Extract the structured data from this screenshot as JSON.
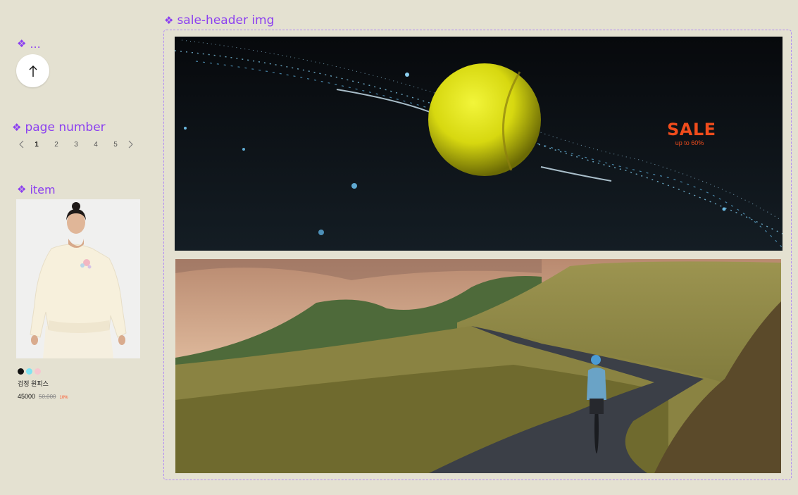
{
  "labels": {
    "scroll": "...",
    "page_number": "page number",
    "item": "item",
    "sale_header": "sale-header img"
  },
  "component_glyph": "❖",
  "scroll_top": {
    "icon": "arrow-up-icon"
  },
  "pager": {
    "prev_icon": "chevron-left-icon",
    "next_icon": "chevron-right-icon",
    "pages": [
      "1",
      "2",
      "3",
      "4",
      "5"
    ],
    "active": "1"
  },
  "item": {
    "name": "검정 원피스",
    "price": "45000",
    "original_price": "50,000",
    "discount": "10%",
    "colors": [
      "#111111",
      "#7fe3f2",
      "#f6c7cf"
    ]
  },
  "sale": {
    "title": "SALE",
    "subtitle": "up to 60%"
  },
  "colors": {
    "accent": "#8b3ff0",
    "sale": "#f04c1c",
    "background": "#e4e1d1"
  }
}
